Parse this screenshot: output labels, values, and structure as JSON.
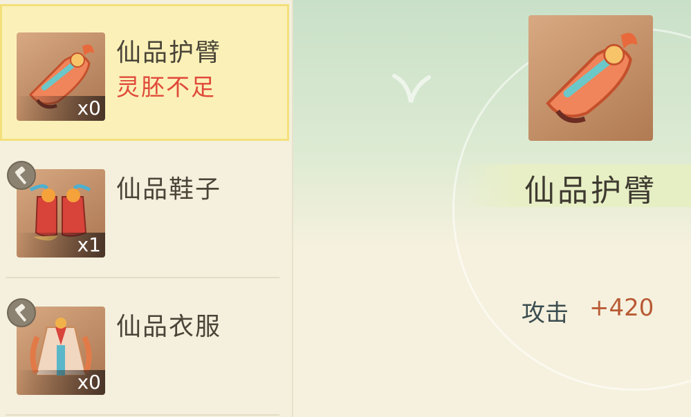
{
  "items": [
    {
      "name": "仙品护臂",
      "status": "灵胚不足",
      "count": "x0"
    },
    {
      "name": "仙品鞋子",
      "count": "x1"
    },
    {
      "name": "仙品衣服",
      "count": "x0"
    }
  ],
  "detail": {
    "name": "仙品护臂",
    "stat_label": "攻击",
    "stat_value": "+420"
  },
  "colors": {
    "status_warning": "#e04a3a",
    "stat_value": "#b85a34",
    "selected_bg": "#fbf1b8"
  },
  "icons": {
    "item_0": "bracer-icon",
    "item_1": "boots-icon",
    "item_2": "robe-icon",
    "forge": "hammer-icon"
  }
}
